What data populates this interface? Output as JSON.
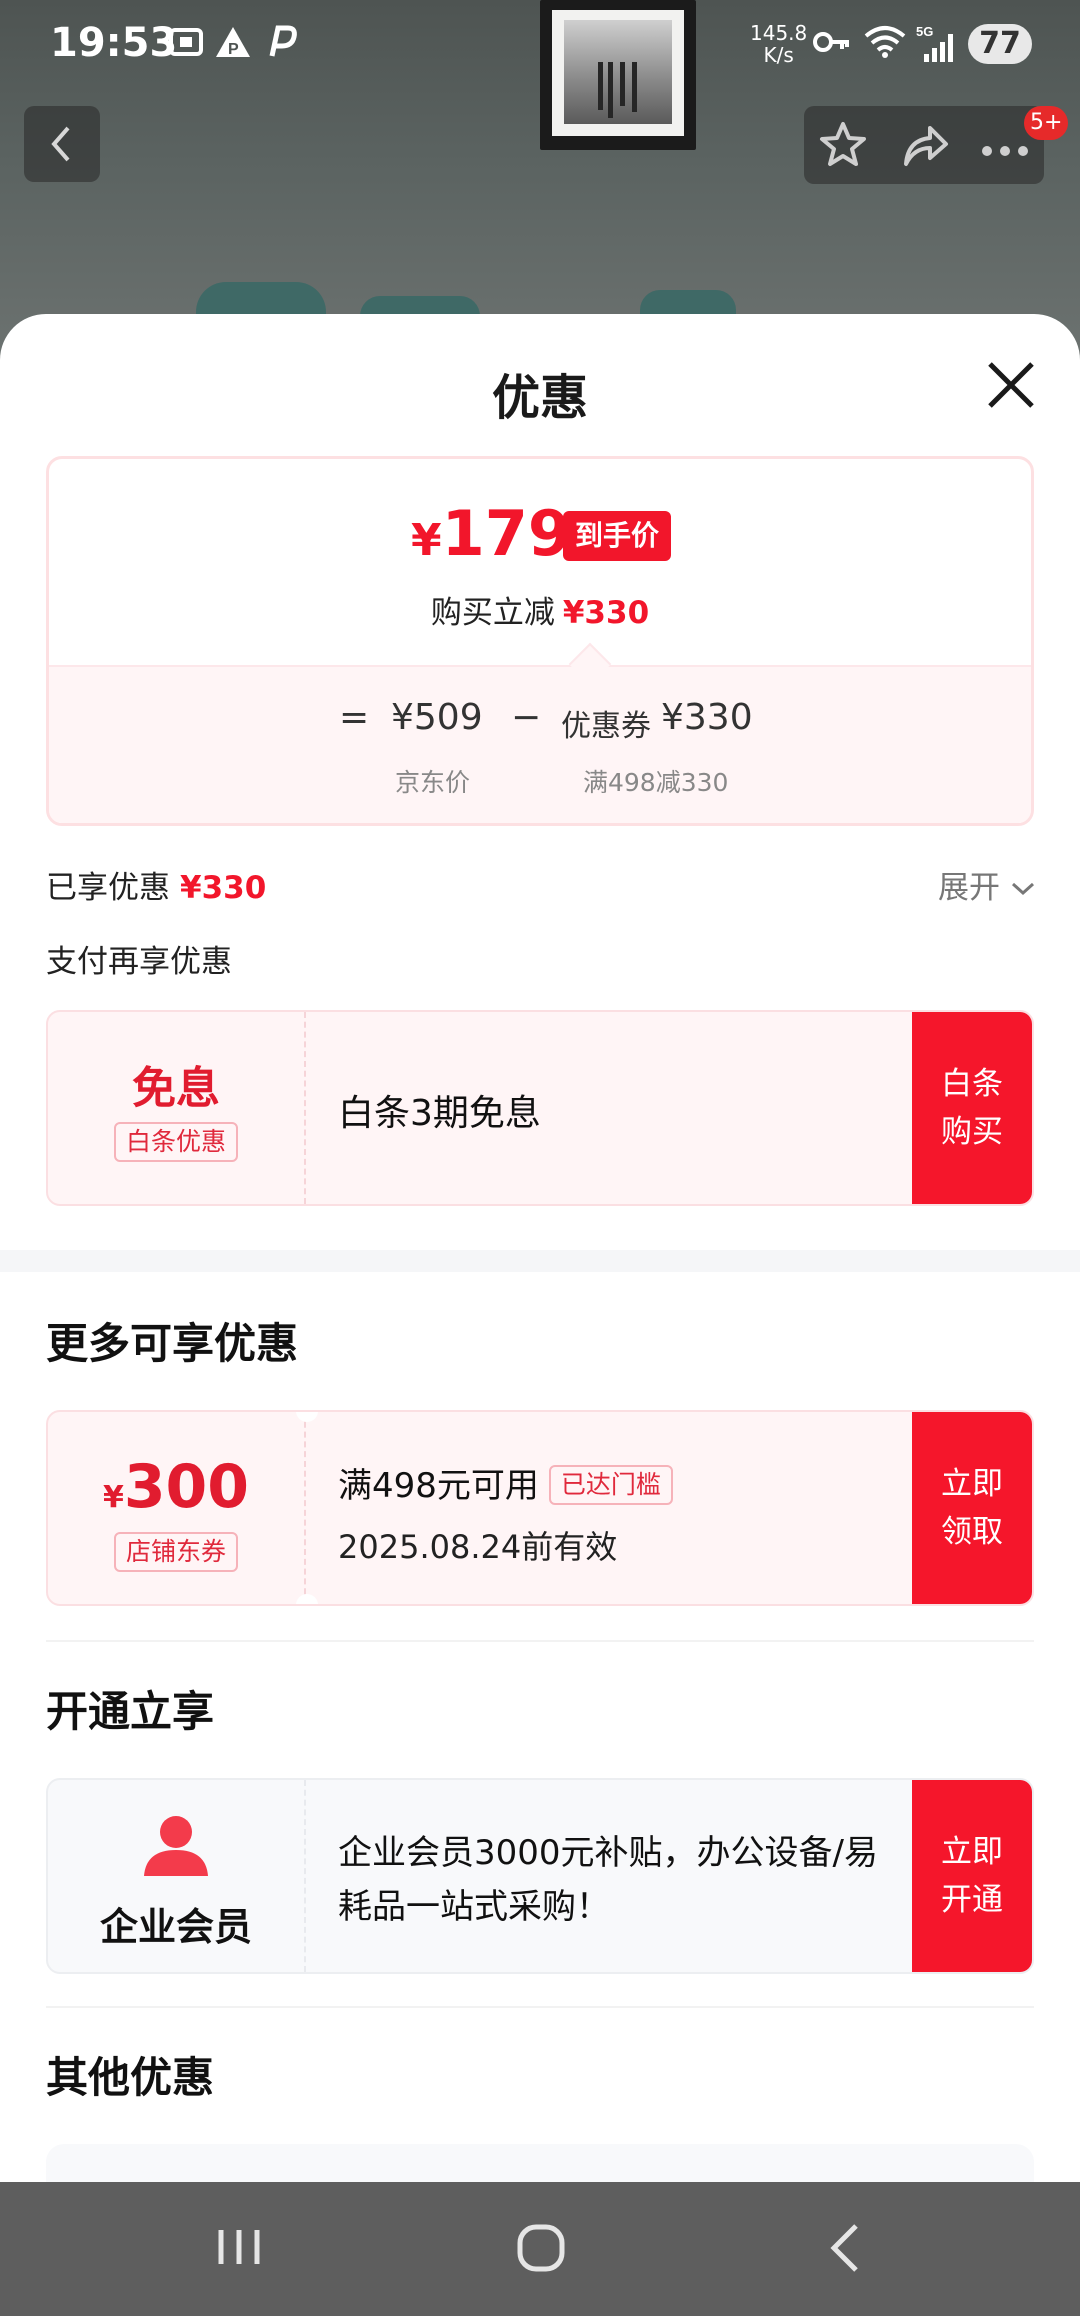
{
  "status_bar": {
    "time": "19:53",
    "net_speed_value": "145.8",
    "net_speed_unit": "K/s",
    "battery": "77",
    "badge": "5+"
  },
  "sheet": {
    "title": "优惠"
  },
  "summary": {
    "currency": "¥",
    "final_price": "179",
    "price_tag": "到手价",
    "reduce_label": "购买立减",
    "reduce_amount": "¥330",
    "equals": "=",
    "jd_price": "¥509",
    "minus": "−",
    "coupon_label": "优惠券",
    "coupon_amount": "¥330",
    "jd_price_label": "京东价",
    "coupon_rule": "满498减330"
  },
  "saved": {
    "label": "已享优惠",
    "amount": "¥330",
    "expand": "展开"
  },
  "pay_section": {
    "title": "支付再享优惠",
    "coupon": {
      "big": "免息",
      "tag": "白条优惠",
      "text": "白条3期免息",
      "cta_line1": "白条",
      "cta_line2": "购买"
    }
  },
  "more_section": {
    "title": "更多可享优惠",
    "coupon": {
      "currency": "¥",
      "amount": "300",
      "tag": "店铺东券",
      "condition": "满498元可用",
      "status": "已达门槛",
      "expiry": "2025.08.24前有效",
      "cta_line1": "立即",
      "cta_line2": "领取"
    }
  },
  "open_section": {
    "title": "开通立享",
    "card": {
      "name": "企业会员",
      "desc": " 企业会员3000元补贴，办公设备/易耗品一站式采购！",
      "cta_line1": "立即",
      "cta_line2": "开通"
    }
  },
  "other_section": {
    "title": "其他优惠"
  },
  "colors": {
    "accent": "#f5162b",
    "coupon_bg": "#fff5f6",
    "nav_bar": "#5e5e5e"
  }
}
